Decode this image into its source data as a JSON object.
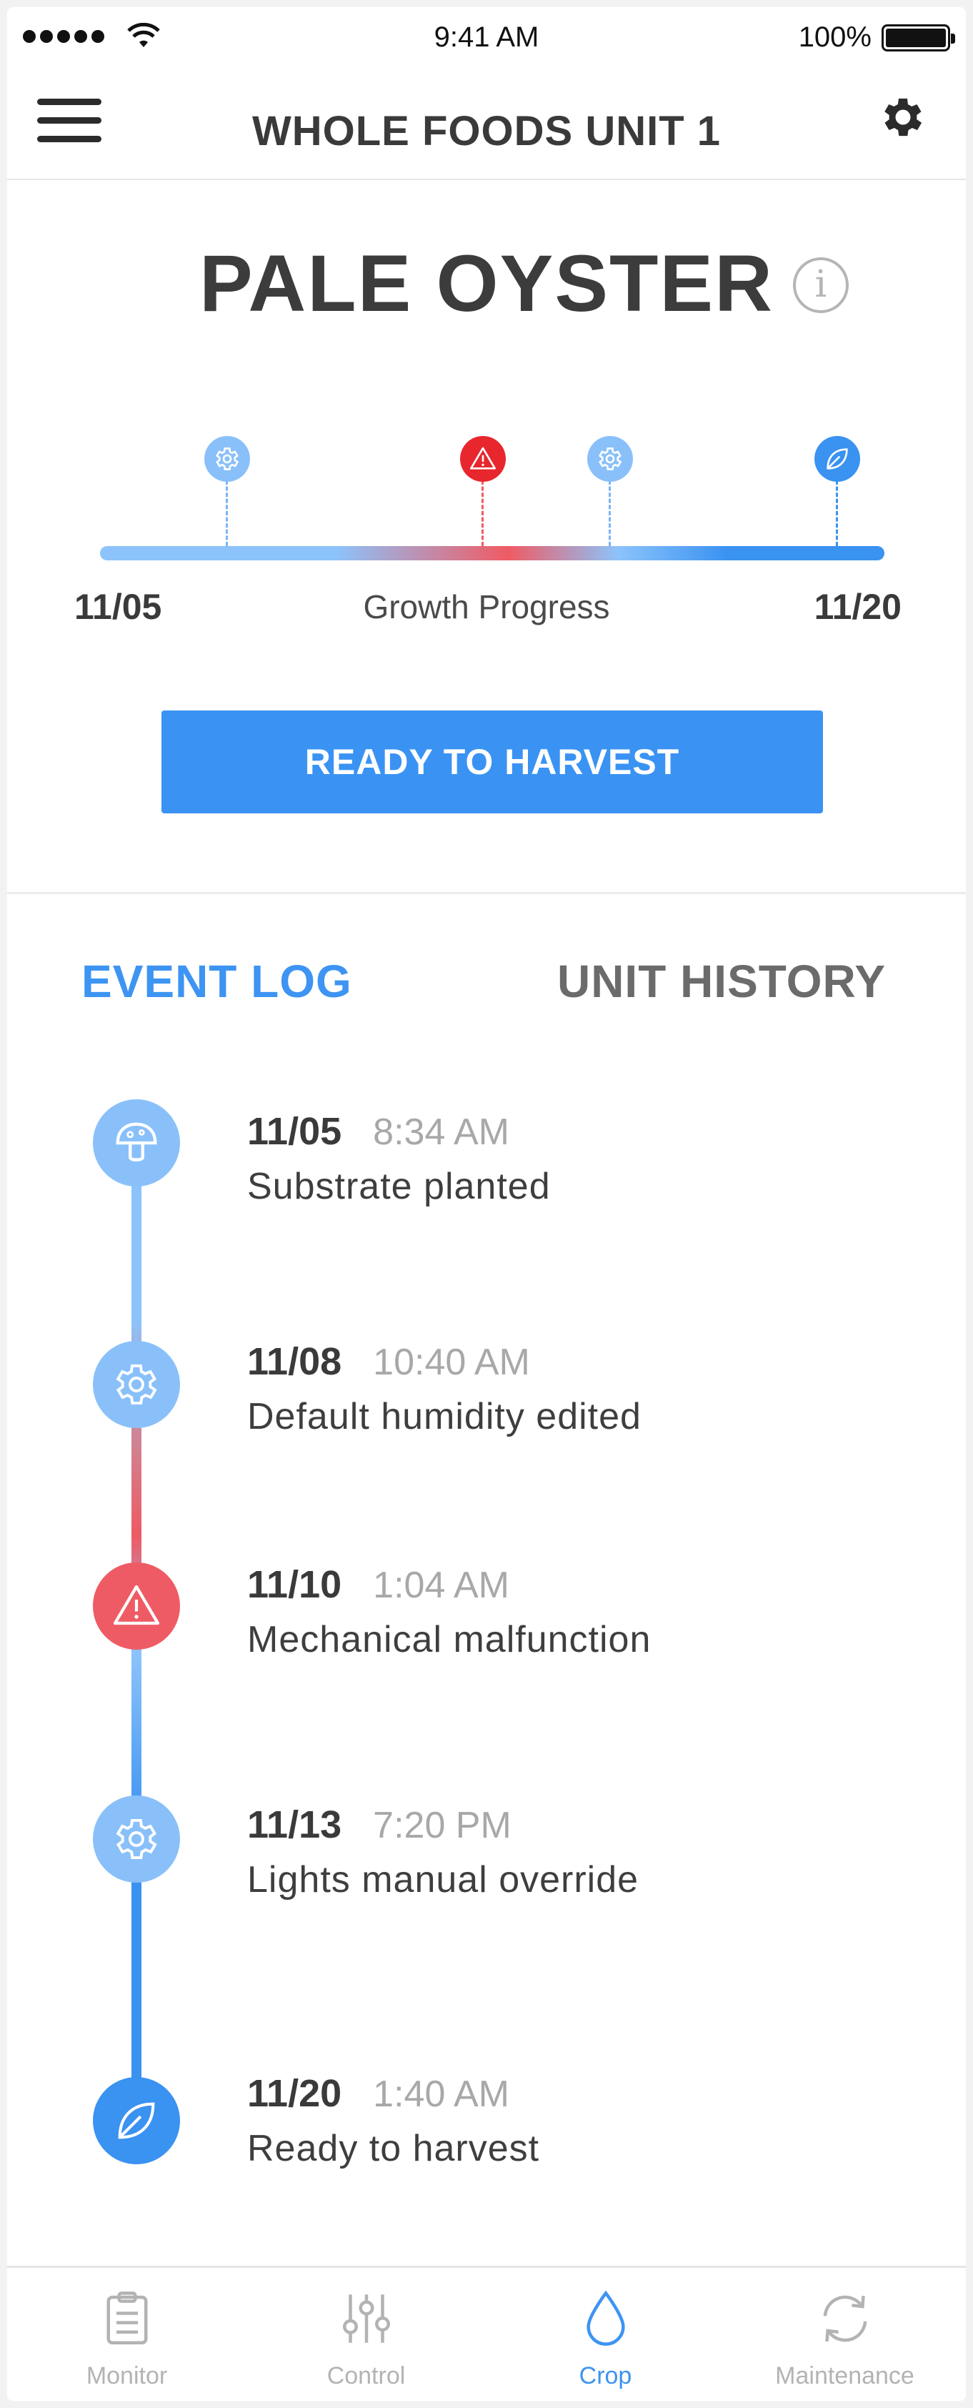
{
  "status_bar": {
    "time": "9:41 AM",
    "battery": "100%"
  },
  "header": {
    "title": "WHOLE FOODS UNIT 1"
  },
  "crop": {
    "name": "PALE OYSTER",
    "info_glyph": "i"
  },
  "growth": {
    "start_date": "11/05",
    "end_date": "11/20",
    "label": "Growth Progress",
    "markers": [
      {
        "icon": "gear-icon",
        "status": "settings"
      },
      {
        "icon": "warning-icon",
        "status": "alert"
      },
      {
        "icon": "gear-icon",
        "status": "settings"
      },
      {
        "icon": "leaf-icon",
        "status": "harvest"
      }
    ]
  },
  "harvest_button": {
    "label": "READY TO HARVEST"
  },
  "tabs": {
    "event_log": "EVENT LOG",
    "unit_history": "UNIT HISTORY",
    "active": "event_log"
  },
  "events": [
    {
      "date": "11/05",
      "time": "8:34 AM",
      "desc": "Substrate planted",
      "icon": "mushroom-icon"
    },
    {
      "date": "11/08",
      "time": "10:40 AM",
      "desc": "Default humidity edited",
      "icon": "gear-icon"
    },
    {
      "date": "11/10",
      "time": "1:04 AM",
      "desc": "Mechanical malfunction",
      "icon": "warning-icon"
    },
    {
      "date": "11/13",
      "time": "7:20 PM",
      "desc": "Lights manual override",
      "icon": "gear-icon"
    },
    {
      "date": "11/20",
      "time": "1:40 AM",
      "desc": "Ready to harvest",
      "icon": "leaf-icon"
    }
  ],
  "nav": {
    "items": [
      {
        "label": "Monitor",
        "icon": "clipboard-icon"
      },
      {
        "label": "Control",
        "icon": "sliders-icon"
      },
      {
        "label": "Crop",
        "icon": "droplet-icon"
      },
      {
        "label": "Maintenance",
        "icon": "refresh-icon"
      }
    ],
    "active": "Crop"
  },
  "colors": {
    "accent": "#3a93f3",
    "alert": "#ef5b64",
    "light_blue": "#89c0fa",
    "muted": "#b3b3b3"
  }
}
